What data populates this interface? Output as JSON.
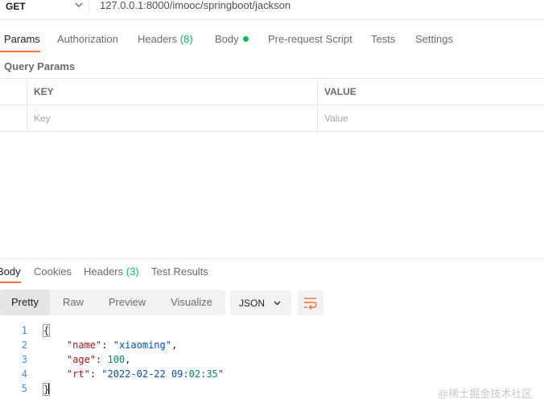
{
  "request": {
    "method": "GET",
    "url": "127.0.0.1:8000/imooc/springboot/jackson"
  },
  "request_tabs": [
    {
      "label": "Params",
      "active": true
    },
    {
      "label": "Authorization"
    },
    {
      "label": "Headers",
      "count": "(8)"
    },
    {
      "label": "Body",
      "indicator": "green-dot"
    },
    {
      "label": "Pre-request Script"
    },
    {
      "label": "Tests"
    },
    {
      "label": "Settings"
    }
  ],
  "query_params": {
    "title": "Query Params",
    "columns": [
      "KEY",
      "VALUE"
    ],
    "placeholders": {
      "key": "Key",
      "value": "Value"
    }
  },
  "response_tabs": [
    {
      "label": "Body",
      "active": true
    },
    {
      "label": "Cookies"
    },
    {
      "label": "Headers",
      "count": "(3)"
    },
    {
      "label": "Test Results"
    }
  ],
  "view_modes": [
    "Pretty",
    "Raw",
    "Preview",
    "Visualize"
  ],
  "active_view": "Pretty",
  "format": {
    "label": "JSON",
    "icon": "chevron-down-icon"
  },
  "wrap_icon": "wrap-lines-icon",
  "code_lines": [
    {
      "num": "1",
      "text": "{"
    },
    {
      "num": "2",
      "text": "    \"name\": \"xiaoming\","
    },
    {
      "num": "3",
      "text": "    \"age\": 100,"
    },
    {
      "num": "4",
      "text": "    \"rt\": \"2022-02-22 09:02:35\""
    },
    {
      "num": "5",
      "text": "}"
    }
  ],
  "watermark": "@稀土掘金技术社区",
  "colors": {
    "accent": "#ff6c37",
    "success": "#0cbb52",
    "line_number": "#3e8fd6"
  }
}
